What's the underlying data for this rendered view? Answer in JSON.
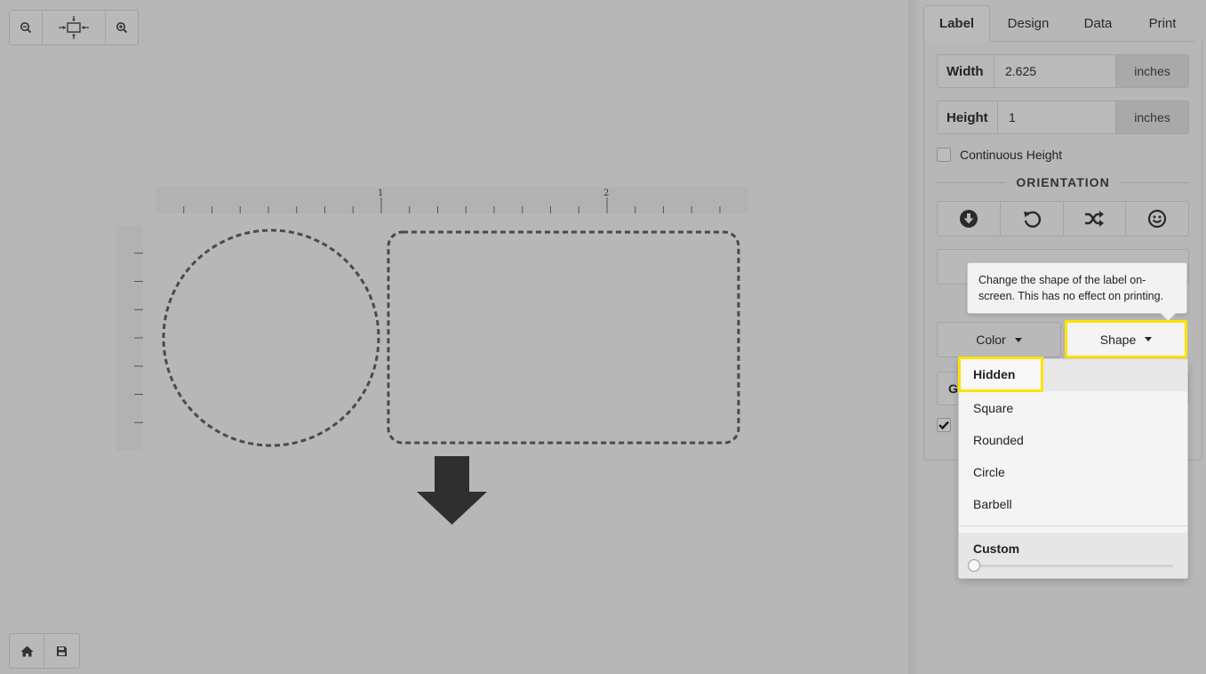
{
  "toolbar": {
    "zoom_out_icon": "zoom-out-icon",
    "fit_icon": "fit-to-screen-icon",
    "zoom_in_icon": "zoom-in-icon",
    "home_icon": "home-icon",
    "save_icon": "save-icon"
  },
  "canvas": {
    "ruler_labels": [
      "1",
      "2"
    ],
    "direction_icon": "arrow-down-icon"
  },
  "tabs": [
    {
      "label": "Label",
      "active": true
    },
    {
      "label": "Design",
      "active": false
    },
    {
      "label": "Data",
      "active": false
    },
    {
      "label": "Print",
      "active": false
    }
  ],
  "label_panel": {
    "width": {
      "label": "Width",
      "value": "2.625",
      "unit": "inches"
    },
    "height": {
      "label": "Height",
      "value": "1",
      "unit": "inches"
    },
    "continuous_height_label": "Continuous Height",
    "continuous_height_checked": false,
    "orientation_title": "ORIENTATION",
    "orientation_icons": [
      "arrow-circle-down-icon",
      "rotate-icon",
      "shuffle-icon",
      "smile-icon"
    ],
    "color_label": "Color",
    "shape_label": "Shape",
    "partial_row_letter": "G",
    "checkbox_checked": true
  },
  "tooltip": {
    "text": "Change the shape of the label on-screen. This has no effect on printing."
  },
  "shape_menu": {
    "items": [
      "Hidden",
      "Square",
      "Rounded",
      "Circle",
      "Barbell"
    ],
    "selected": "Hidden",
    "custom_label": "Custom",
    "custom_value": 0
  },
  "colors": {
    "highlight": "#ffe200",
    "overlay": "#b7b7b7"
  }
}
